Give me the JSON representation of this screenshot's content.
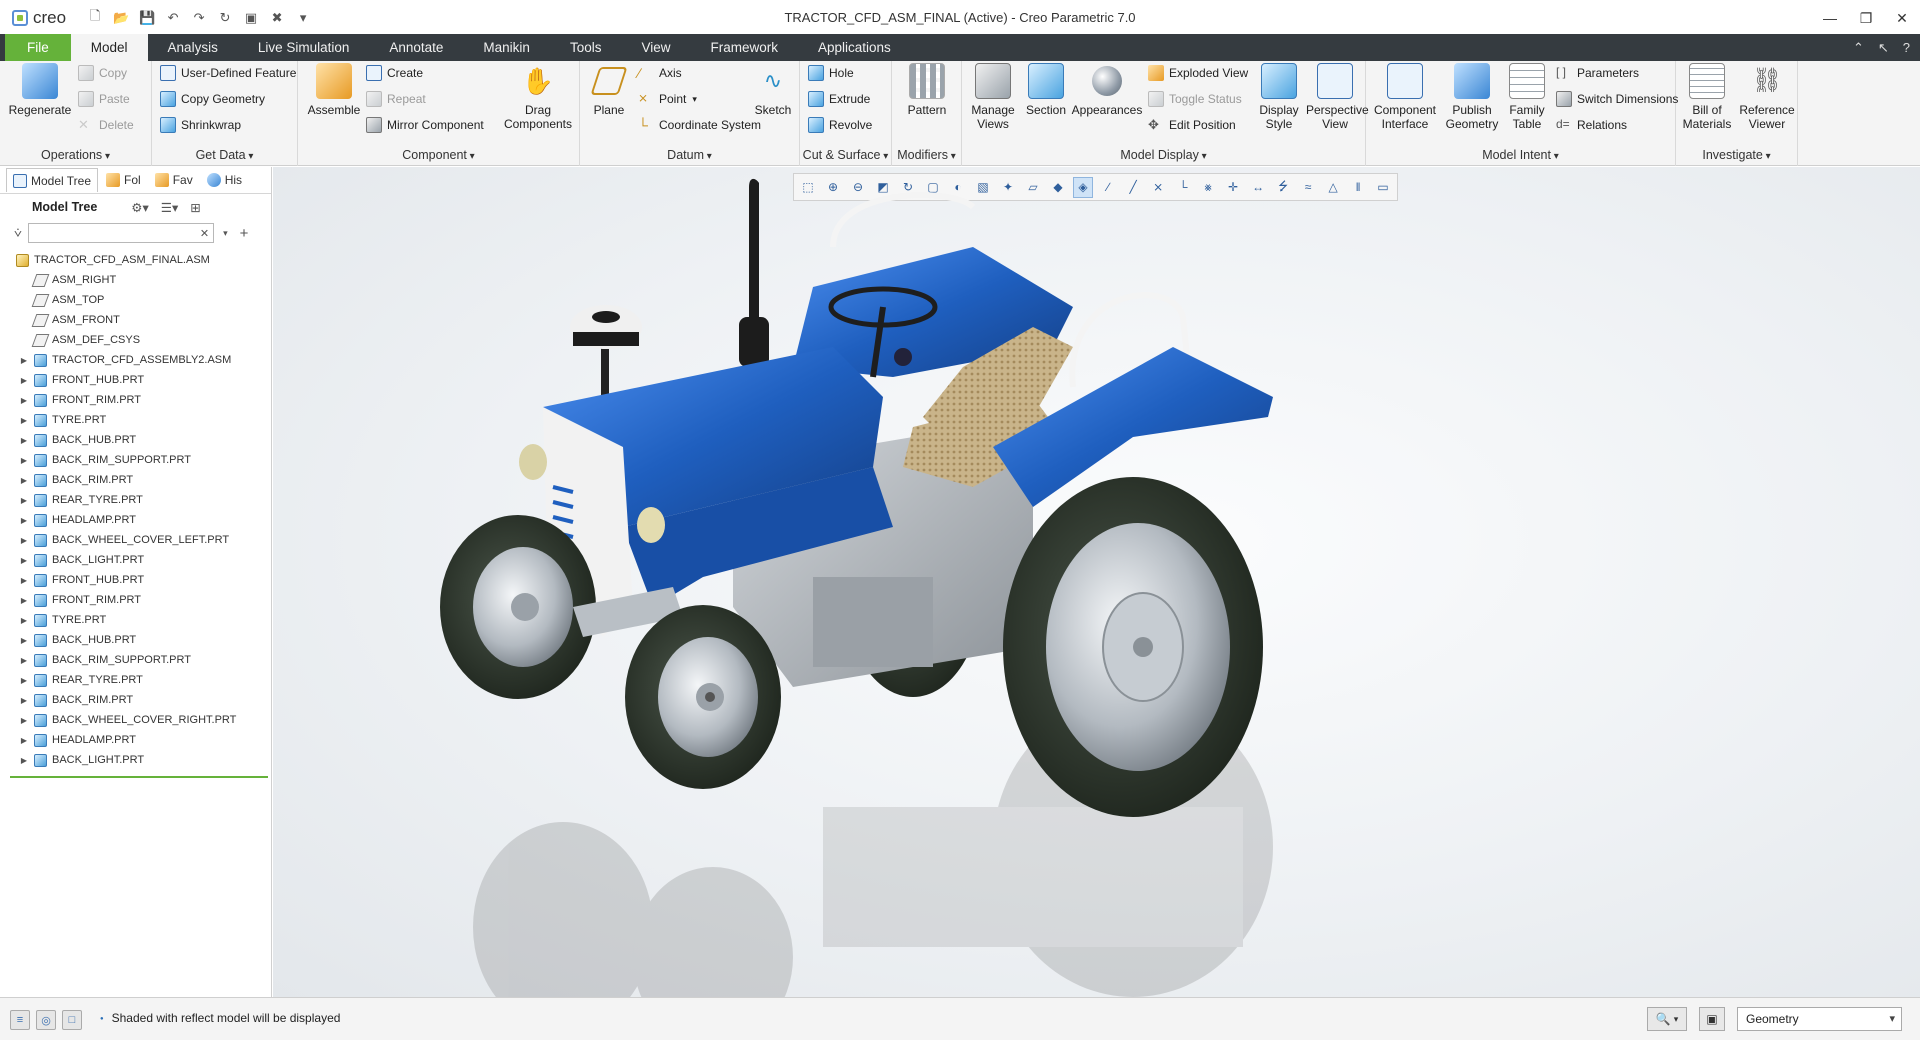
{
  "app": {
    "logo": "creo",
    "window_title": "TRACTOR_CFD_ASM_FINAL (Active) - Creo Parametric 7.0"
  },
  "tabs": [
    {
      "label": "File"
    },
    {
      "label": "Model"
    },
    {
      "label": "Analysis"
    },
    {
      "label": "Live Simulation"
    },
    {
      "label": "Annotate"
    },
    {
      "label": "Manikin"
    },
    {
      "label": "Tools"
    },
    {
      "label": "View"
    },
    {
      "label": "Framework"
    },
    {
      "label": "Applications"
    }
  ],
  "ribbon": {
    "operations": {
      "label": "Operations",
      "regenerate": "Regenerate",
      "copy": "Copy",
      "paste": "Paste",
      "delete": "Delete"
    },
    "getdata": {
      "label": "Get Data",
      "udf": "User-Defined Feature",
      "copy_geometry": "Copy Geometry",
      "shrinkwrap": "Shrinkwrap"
    },
    "component": {
      "label": "Component",
      "assemble": "Assemble",
      "create": "Create",
      "repeat": "Repeat",
      "mirror": "Mirror Component",
      "drag": "Drag Components"
    },
    "datum": {
      "label": "Datum",
      "plane": "Plane",
      "axis": "Axis",
      "point": "Point",
      "csys": "Coordinate System",
      "sketch": "Sketch"
    },
    "cut_surface": {
      "label": "Cut & Surface",
      "hole": "Hole",
      "extrude": "Extrude",
      "revolve": "Revolve"
    },
    "modifiers": {
      "label": "Modifiers",
      "pattern": "Pattern"
    },
    "model_display": {
      "label": "Model Display",
      "manage_views": "Manage Views",
      "section": "Section",
      "appearances": "Appearances",
      "exploded_view": "Exploded View",
      "toggle_status": "Toggle Status",
      "edit_position": "Edit Position",
      "display_style": "Display Style",
      "perspective_view": "Perspective View"
    },
    "model_intent": {
      "label": "Model Intent",
      "component_interface": "Component Interface",
      "publish_geometry": "Publish Geometry",
      "family_table": "Family Table",
      "parameters": "Parameters",
      "switch_dimensions": "Switch Dimensions",
      "relations": "Relations"
    },
    "investigate": {
      "label": "Investigate",
      "bom": "Bill of Materials",
      "reference_viewer": "Reference Viewer"
    }
  },
  "navigator": {
    "tabs": [
      {
        "label": "Model Tree"
      },
      {
        "label": "Fol"
      },
      {
        "label": "Fav"
      },
      {
        "label": "His"
      }
    ],
    "header": "Model Tree",
    "search_placeholder": "",
    "items": [
      {
        "label": "TRACTOR_CFD_ASM_FINAL.ASM",
        "kind": "root"
      },
      {
        "label": "ASM_RIGHT",
        "kind": "datum"
      },
      {
        "label": "ASM_TOP",
        "kind": "datum"
      },
      {
        "label": "ASM_FRONT",
        "kind": "datum"
      },
      {
        "label": "ASM_DEF_CSYS",
        "kind": "csys"
      },
      {
        "label": "TRACTOR_CFD_ASSEMBLY2.ASM",
        "kind": "asm"
      },
      {
        "label": "FRONT_HUB.PRT",
        "kind": "part"
      },
      {
        "label": "FRONT_RIM.PRT",
        "kind": "part"
      },
      {
        "label": "TYRE.PRT",
        "kind": "part"
      },
      {
        "label": "BACK_HUB.PRT",
        "kind": "part"
      },
      {
        "label": "BACK_RIM_SUPPORT.PRT",
        "kind": "part"
      },
      {
        "label": "BACK_RIM.PRT",
        "kind": "part"
      },
      {
        "label": "REAR_TYRE.PRT",
        "kind": "part"
      },
      {
        "label": "HEADLAMP.PRT",
        "kind": "part"
      },
      {
        "label": "BACK_WHEEL_COVER_LEFT.PRT",
        "kind": "part"
      },
      {
        "label": "BACK_LIGHT.PRT",
        "kind": "part"
      },
      {
        "label": "FRONT_HUB.PRT",
        "kind": "part"
      },
      {
        "label": "FRONT_RIM.PRT",
        "kind": "part"
      },
      {
        "label": "TYRE.PRT",
        "kind": "part"
      },
      {
        "label": "BACK_HUB.PRT",
        "kind": "part"
      },
      {
        "label": "BACK_RIM_SUPPORT.PRT",
        "kind": "part"
      },
      {
        "label": "REAR_TYRE.PRT",
        "kind": "part"
      },
      {
        "label": "BACK_RIM.PRT",
        "kind": "part"
      },
      {
        "label": "BACK_WHEEL_COVER_RIGHT.PRT",
        "kind": "part"
      },
      {
        "label": "HEADLAMP.PRT",
        "kind": "part"
      },
      {
        "label": "BACK_LIGHT.PRT",
        "kind": "part"
      }
    ]
  },
  "status": {
    "message": "Shaded with reflect model will be displayed",
    "filter_value": "Geometry"
  },
  "colors": {
    "file_tab": "#65b23a",
    "tabbar": "#353b40",
    "tractor_blue": "#1f5fbf",
    "tyre": "#2f3a2e"
  }
}
